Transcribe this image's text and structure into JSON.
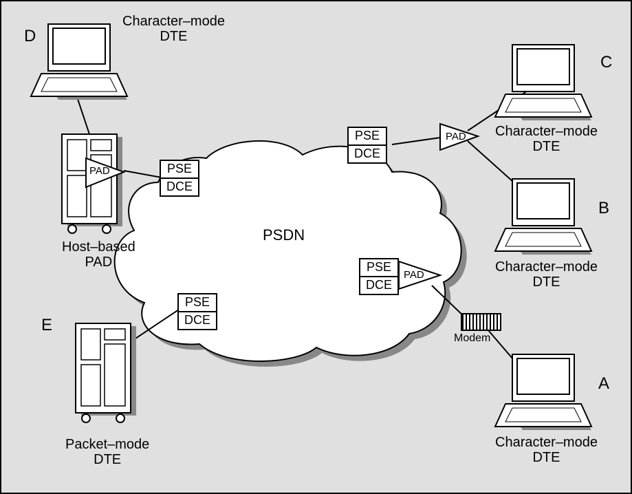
{
  "title_top_left": "Character–mode\nDTE",
  "letters": {
    "D": "D",
    "C": "C",
    "B": "B",
    "A": "A",
    "E": "E"
  },
  "host_pad_label": "Host–based\nPAD",
  "packet_mode_label": "Packet–mode\nDTE",
  "psdn_label": "PSDN",
  "char_mode_c": "Character–mode\nDTE",
  "char_mode_b": "Character–mode\nDTE",
  "char_mode_a": "Character–mode\nDTE",
  "pse_dce": {
    "pse": "PSE",
    "dce": "DCE"
  },
  "pad_text": "PAD",
  "modem_label": "Modem"
}
